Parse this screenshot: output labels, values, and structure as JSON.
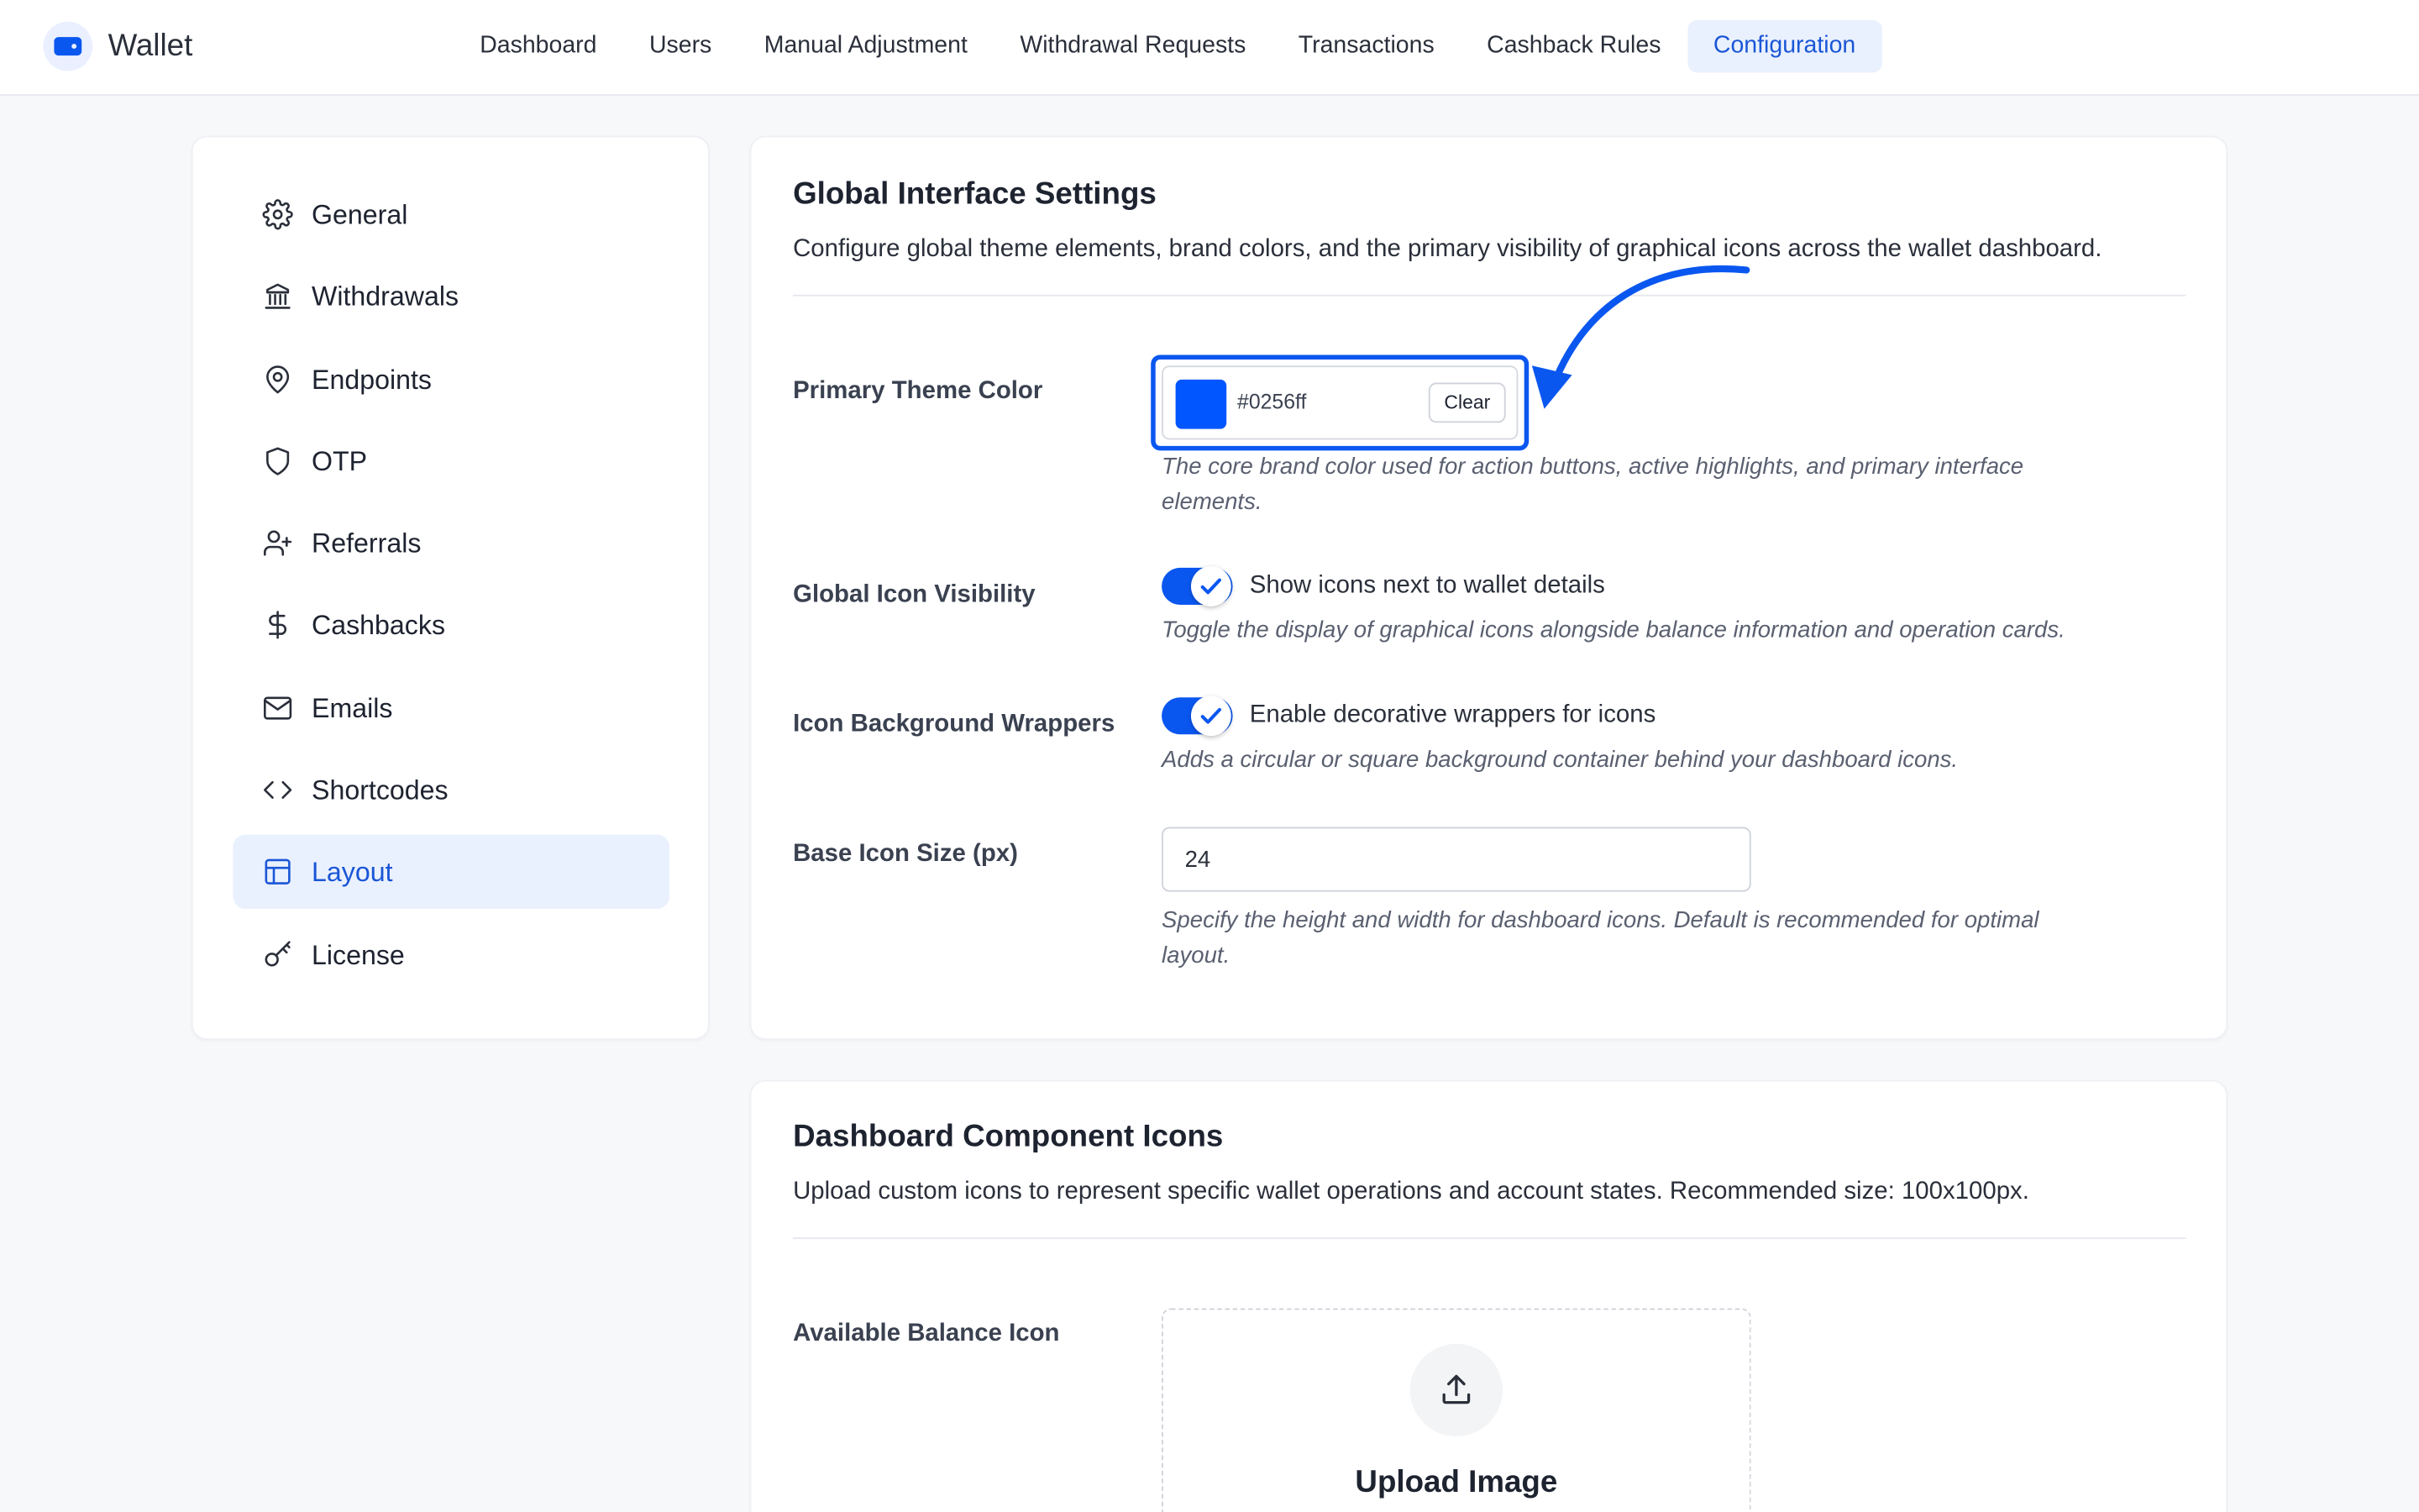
{
  "app": {
    "name": "Wallet",
    "accent": "#0a57f0"
  },
  "nav": {
    "items": [
      {
        "label": "Dashboard"
      },
      {
        "label": "Users"
      },
      {
        "label": "Manual Adjustment"
      },
      {
        "label": "Withdrawal Requests"
      },
      {
        "label": "Transactions"
      },
      {
        "label": "Cashback Rules"
      },
      {
        "label": "Configuration",
        "active": true
      }
    ]
  },
  "sidebar": {
    "items": [
      {
        "label": "General",
        "icon": "gear-icon"
      },
      {
        "label": "Withdrawals",
        "icon": "bank-icon"
      },
      {
        "label": "Endpoints",
        "icon": "map-pin-icon"
      },
      {
        "label": "OTP",
        "icon": "shield-icon"
      },
      {
        "label": "Referrals",
        "icon": "user-plus-icon"
      },
      {
        "label": "Cashbacks",
        "icon": "dollar-icon"
      },
      {
        "label": "Emails",
        "icon": "mail-icon"
      },
      {
        "label": "Shortcodes",
        "icon": "code-icon"
      },
      {
        "label": "Layout",
        "icon": "layout-icon",
        "active": true
      },
      {
        "label": "License",
        "icon": "key-icon"
      }
    ]
  },
  "global_settings": {
    "title": "Global Interface Settings",
    "description": "Configure global theme elements, brand colors, and the primary visibility of graphical icons across the wallet dashboard.",
    "theme_color": {
      "label": "Primary Theme Color",
      "value": "#0256ff",
      "clear_label": "Clear",
      "help_line1": "The core brand color used for action buttons, active highlights, and primary interface",
      "help_line2": "elements."
    },
    "icon_visibility": {
      "label": "Global Icon Visibility",
      "enabled": true,
      "toggle_label": "Show icons next to wallet details",
      "help": "Toggle the display of graphical icons alongside balance information and operation cards."
    },
    "icon_wrappers": {
      "label": "Icon Background Wrappers",
      "enabled": true,
      "toggle_label": "Enable decorative wrappers for icons",
      "help": "Adds a circular or square background container behind your dashboard icons."
    },
    "icon_size": {
      "label": "Base Icon Size (px)",
      "value": "24",
      "help_line1": "Specify the height and width for dashboard icons. Default is recommended for optimal",
      "help_line2": "layout."
    }
  },
  "component_icons": {
    "title": "Dashboard Component Icons",
    "description": "Upload custom icons to represent specific wallet operations and account states. Recommended size: 100x100px.",
    "balance_icon": {
      "label": "Available Balance Icon",
      "upload_label": "Upload Image"
    }
  }
}
